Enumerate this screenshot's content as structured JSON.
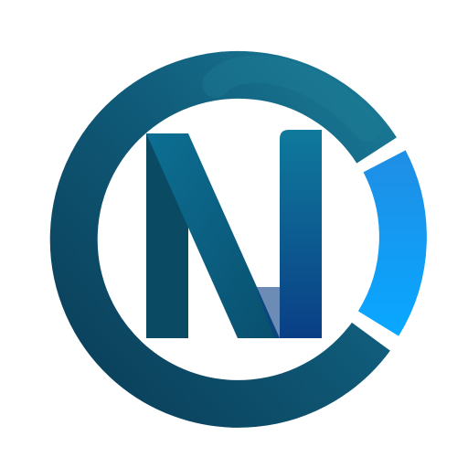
{
  "logo": {
    "letter": "N",
    "colors": {
      "background": "#ffffff",
      "ring_dark": "#0a3d57",
      "ring_mid": "#0f5a78",
      "ring_light": "#1a7a96",
      "segment_blue_top": "#1e8fe6",
      "segment_blue_bottom": "#0aa6ff",
      "letter_left": "#0b4a63",
      "letter_diagonal": "#0c6f93",
      "letter_right_top": "#0f7a9c",
      "letter_right_bottom": "#0a3f86"
    }
  }
}
